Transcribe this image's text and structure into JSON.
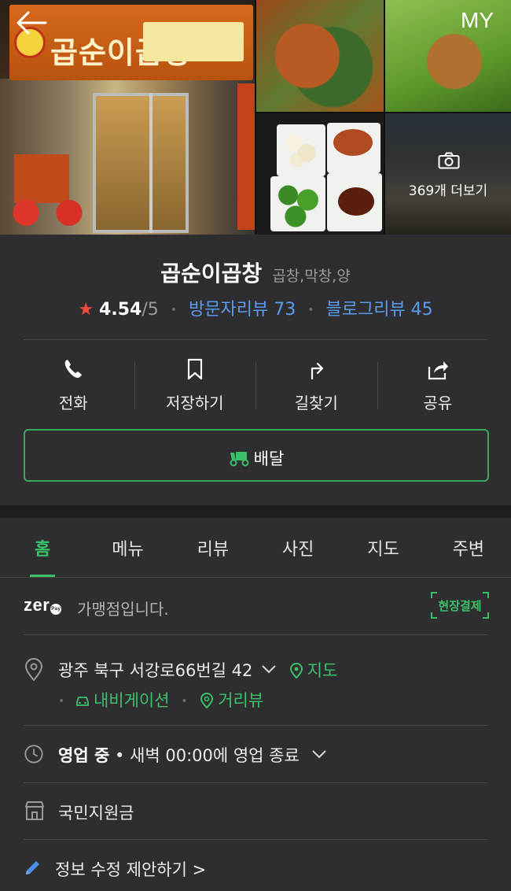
{
  "header": {
    "my_label": "MY",
    "more_photos_label": "369개 더보기"
  },
  "place": {
    "name": "곱순이곱창",
    "category": "곱창,막창,양",
    "rating": "4.54",
    "rating_max": "/5",
    "visitor_reviews": "방문자리뷰 73",
    "blog_reviews": "블로그리뷰 45"
  },
  "actions": [
    {
      "label": "전화",
      "icon": "phone-icon"
    },
    {
      "label": "저장하기",
      "icon": "bookmark-icon"
    },
    {
      "label": "길찾기",
      "icon": "directions-icon"
    },
    {
      "label": "공유",
      "icon": "share-icon"
    }
  ],
  "delivery": {
    "label": "배달"
  },
  "tabs": [
    "홈",
    "메뉴",
    "리뷰",
    "사진",
    "지도",
    "주변"
  ],
  "zero_pay": {
    "logo_text": "zer",
    "pay_text": "Pay",
    "text": "가맹점입니다.",
    "badge": "현장결제"
  },
  "address": {
    "text": "광주 북구 서강로66번길 42",
    "map_link": "지도",
    "navigation_link": "내비게이션",
    "street_view_link": "거리뷰"
  },
  "hours": {
    "status": "영업 중",
    "detail": "• 새벽 00:00에 영업 종료"
  },
  "support_fund": "국민지원금",
  "edit_suggestion": "정보 수정 제안하기 >",
  "colors": {
    "background": "#2e2e30",
    "accent_green": "#3bc06a",
    "link_blue": "#5a9bf0",
    "star_red": "#f24a3d"
  }
}
